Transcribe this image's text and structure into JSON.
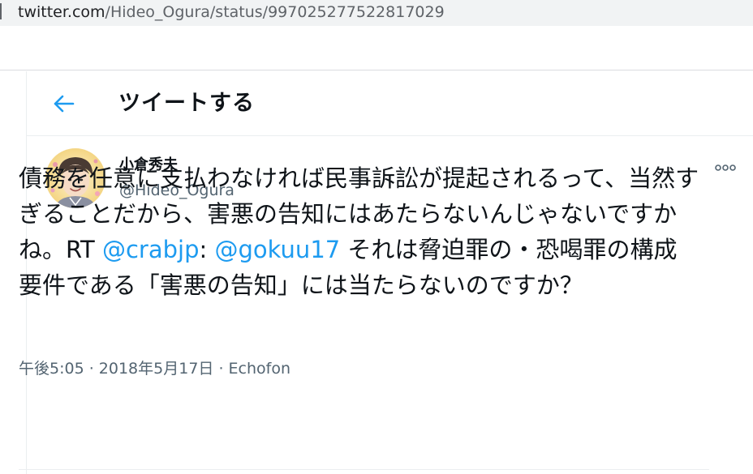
{
  "browser": {
    "url_host": "twitter.com",
    "url_path": "/Hideo_Ogura/status/997025277522817029"
  },
  "header": {
    "title": "ツイートする"
  },
  "tweet": {
    "author_name": "小倉秀夫",
    "author_handle": "@Hideo_Ogura",
    "text_part1": "債務を任意に支払わなければ民事訴訟が提起されるって、当然すぎることだから、害悪の告知にはあたらないんじゃないですかね。RT ",
    "mention1": "@crabjp",
    "text_part2": ":  ",
    "mention2": "@gokuu17",
    "text_part3": " それは脅迫罪の・恐喝罪の構成要件である「害悪の告知」には当たらないのですか？",
    "time": "午後5:05",
    "separator": " · ",
    "date": "2018年5月17日",
    "source": "Echofon"
  },
  "icons": {
    "back": "arrow-left-icon",
    "more": "more-horizontal-icon"
  },
  "colors": {
    "accent": "#1d9bf0",
    "text": "#0f1419",
    "secondary": "#536471"
  }
}
